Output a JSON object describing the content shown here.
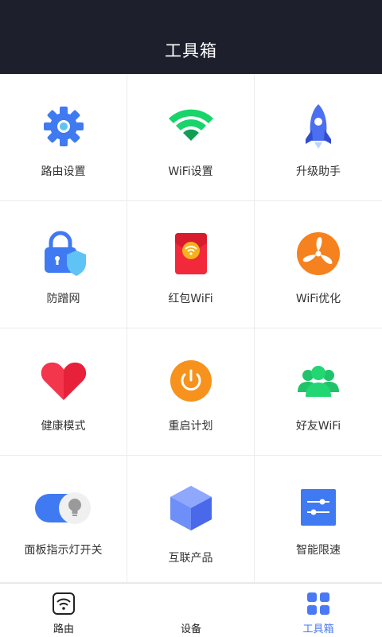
{
  "header": {
    "title": "工具箱"
  },
  "tools": [
    {
      "label": "路由设置",
      "icon": "gear-icon"
    },
    {
      "label": "WiFi设置",
      "icon": "wifi-icon"
    },
    {
      "label": "升级助手",
      "icon": "rocket-icon"
    },
    {
      "label": "防蹭网",
      "icon": "lock-shield-icon"
    },
    {
      "label": "红包WiFi",
      "icon": "red-envelope-wifi-icon"
    },
    {
      "label": "WiFi优化",
      "icon": "fan-icon"
    },
    {
      "label": "健康模式",
      "icon": "heart-icon"
    },
    {
      "label": "重启计划",
      "icon": "power-icon"
    },
    {
      "label": "好友WiFi",
      "icon": "friends-icon"
    },
    {
      "label": "面板指示灯开关",
      "icon": "toggle-bulb-icon"
    },
    {
      "label": "互联产品",
      "icon": "cube-icon"
    },
    {
      "label": "智能限速",
      "icon": "sliders-icon"
    }
  ],
  "tabbar": {
    "items": [
      {
        "label": "路由",
        "icon": "router-wifi-icon",
        "active": false
      },
      {
        "label": "设备",
        "icon": "devices-icon",
        "active": false
      },
      {
        "label": "工具箱",
        "icon": "grid-icon",
        "active": true
      }
    ]
  },
  "colors": {
    "header_bg": "#1d1f2d",
    "accent": "#4a79f5"
  }
}
